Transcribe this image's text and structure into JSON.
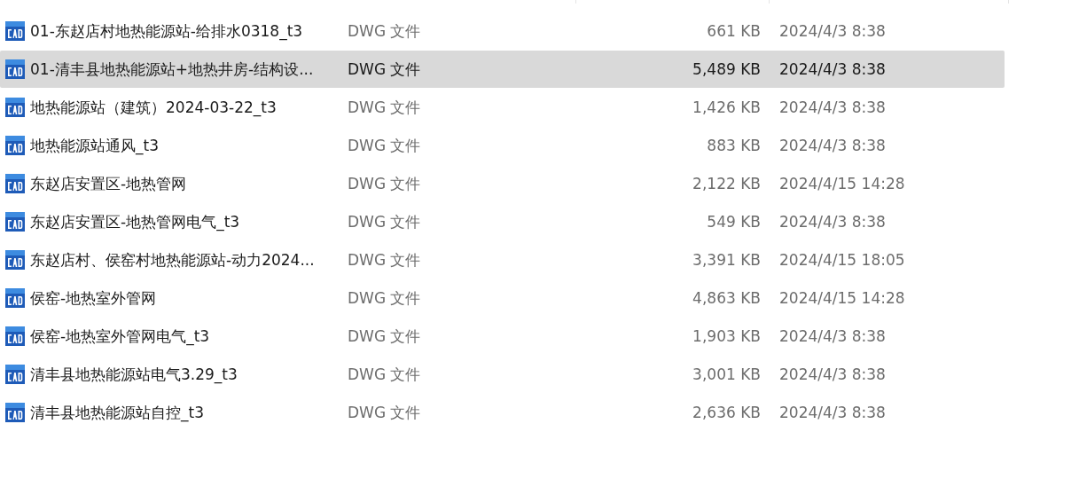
{
  "files": [
    {
      "name": "01-东赵店村地热能源站-给排水0318_t3",
      "type": "DWG 文件",
      "size": "661 KB",
      "modified": "2024/4/3 8:38",
      "selected": false
    },
    {
      "name": "01-清丰县地热能源站+地热井房-结构设...",
      "type": "DWG 文件",
      "size": "5,489 KB",
      "modified": "2024/4/3 8:38",
      "selected": true
    },
    {
      "name": "地热能源站（建筑）2024-03-22_t3",
      "type": "DWG 文件",
      "size": "1,426 KB",
      "modified": "2024/4/3 8:38",
      "selected": false
    },
    {
      "name": "地热能源站通风_t3",
      "type": "DWG 文件",
      "size": "883 KB",
      "modified": "2024/4/3 8:38",
      "selected": false
    },
    {
      "name": "东赵店安置区-地热管网",
      "type": "DWG 文件",
      "size": "2,122 KB",
      "modified": "2024/4/15 14:28",
      "selected": false
    },
    {
      "name": "东赵店安置区-地热管网电气_t3",
      "type": "DWG 文件",
      "size": "549 KB",
      "modified": "2024/4/3 8:38",
      "selected": false
    },
    {
      "name": "东赵店村、侯窑村地热能源站-动力2024...",
      "type": "DWG 文件",
      "size": "3,391 KB",
      "modified": "2024/4/15 18:05",
      "selected": false
    },
    {
      "name": "侯窑-地热室外管网",
      "type": "DWG 文件",
      "size": "4,863 KB",
      "modified": "2024/4/15 14:28",
      "selected": false
    },
    {
      "name": "侯窑-地热室外管网电气_t3",
      "type": "DWG 文件",
      "size": "1,903 KB",
      "modified": "2024/4/3 8:38",
      "selected": false
    },
    {
      "name": "清丰县地热能源站电气3.29_t3",
      "type": "DWG 文件",
      "size": "3,001 KB",
      "modified": "2024/4/3 8:38",
      "selected": false
    },
    {
      "name": "清丰县地热能源站自控_t3",
      "type": "DWG 文件",
      "size": "2,636 KB",
      "modified": "2024/4/3 8:38",
      "selected": false
    }
  ]
}
